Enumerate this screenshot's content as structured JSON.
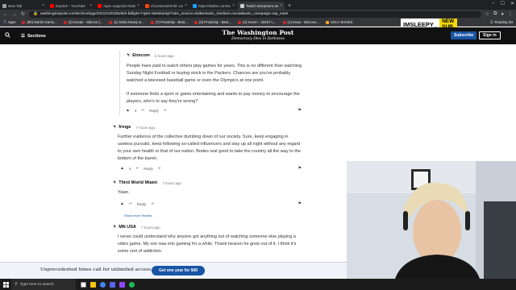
{
  "browser": {
    "tabs": [
      {
        "label": "New Tab",
        "color": "#9aa0a6"
      },
      {
        "label": "Explore - YouTube",
        "color": "#ff0000"
      },
      {
        "label": "Apex Legends Rankers Collectio",
        "color": "#ff0000"
      },
      {
        "label": "r/LivestreamFail: Livestream ann",
        "color": "#ff4500"
      },
      {
        "label": "https://twitter.com/washingto",
        "color": "#1da1f2"
      },
      {
        "label": "Twitch streamers are the Internet",
        "color": "#cccccc"
      }
    ],
    "url": "washingtonpost.com/technology/2021/12/02/twitch-bitbyte-f-tyler-steinkamp/?utm_source=twitter&utm_medium=social&utm_campaign=wp_main",
    "bookmarks": [
      {
        "label": "Apps",
        "icon": "apps-grid-icon"
      },
      {
        "label": "(90) Martin Garrix..."
      },
      {
        "label": "(2) Kovan - Silence [..."
      },
      {
        "label": "(1) Delta Heavy &..."
      },
      {
        "label": "(7) Proximity - Best..."
      },
      {
        "label": "(2) Proximity - Best..."
      },
      {
        "label": "(2) Koven - 32467 L..."
      },
      {
        "label": "(1) Insus - Discove..."
      },
      {
        "label": "UGLY SHOES",
        "yellow": true
      }
    ],
    "reading_list": "Reading list"
  },
  "stream_overlay": {
    "name": "IMSLEEPY_",
    "badge": "NEW SUB"
  },
  "site_header": {
    "sections_label": "Sections",
    "logo": "The Washington Post",
    "tagline": "Democracy Dies in Darkness",
    "subscribe_label": "Subscribe",
    "signin_label": "Sign in"
  },
  "comments": [
    {
      "author": "Etmcom",
      "time": "6 hours ago",
      "paragraphs": [
        "People have paid to watch others play games for years. This is no different than watching Sunday Night Football or buying stock in the Packers. Chances are you've probably watched a televised baseball game or even the Olympics at one point.",
        "If someone finds a sport or game entertaining and wants to pay money to encourage the players, who's to say they're wrong?"
      ],
      "likes": "4",
      "reply_label": "Reply"
    },
    {
      "author": "fringe",
      "time": "7 hours ago",
      "paragraphs": [
        "Further evidence of the collective dumbing down of our society. Sure, keep engaging in useless pursuits, keep following so-called influencers and stay up all night without any regard to your own health or that of our nation. Bodes real good to take the country all the way to the bottom of the barrel."
      ],
      "likes": "4",
      "reply_label": "Reply"
    },
    {
      "author": "Third World Miami",
      "time": "7 hours ago",
      "paragraphs": [
        "Yawn."
      ],
      "likes": "",
      "reply_label": "Reply",
      "show_more": "Show more Replies"
    },
    {
      "author": "MN USA",
      "time": "7 hours ago",
      "paragraphs": [
        "I never could understand why anyone got anything out of watching someone else playing a video game. My son was into gaming for a while. Thank heaven he grew out of it. I think it's some sort of addiction."
      ]
    }
  ],
  "promo": {
    "text": "Unprecedented times call for unlimited access.",
    "button": "Get one year for $40"
  },
  "taskbar": {
    "search_placeholder": "Type here to search"
  }
}
